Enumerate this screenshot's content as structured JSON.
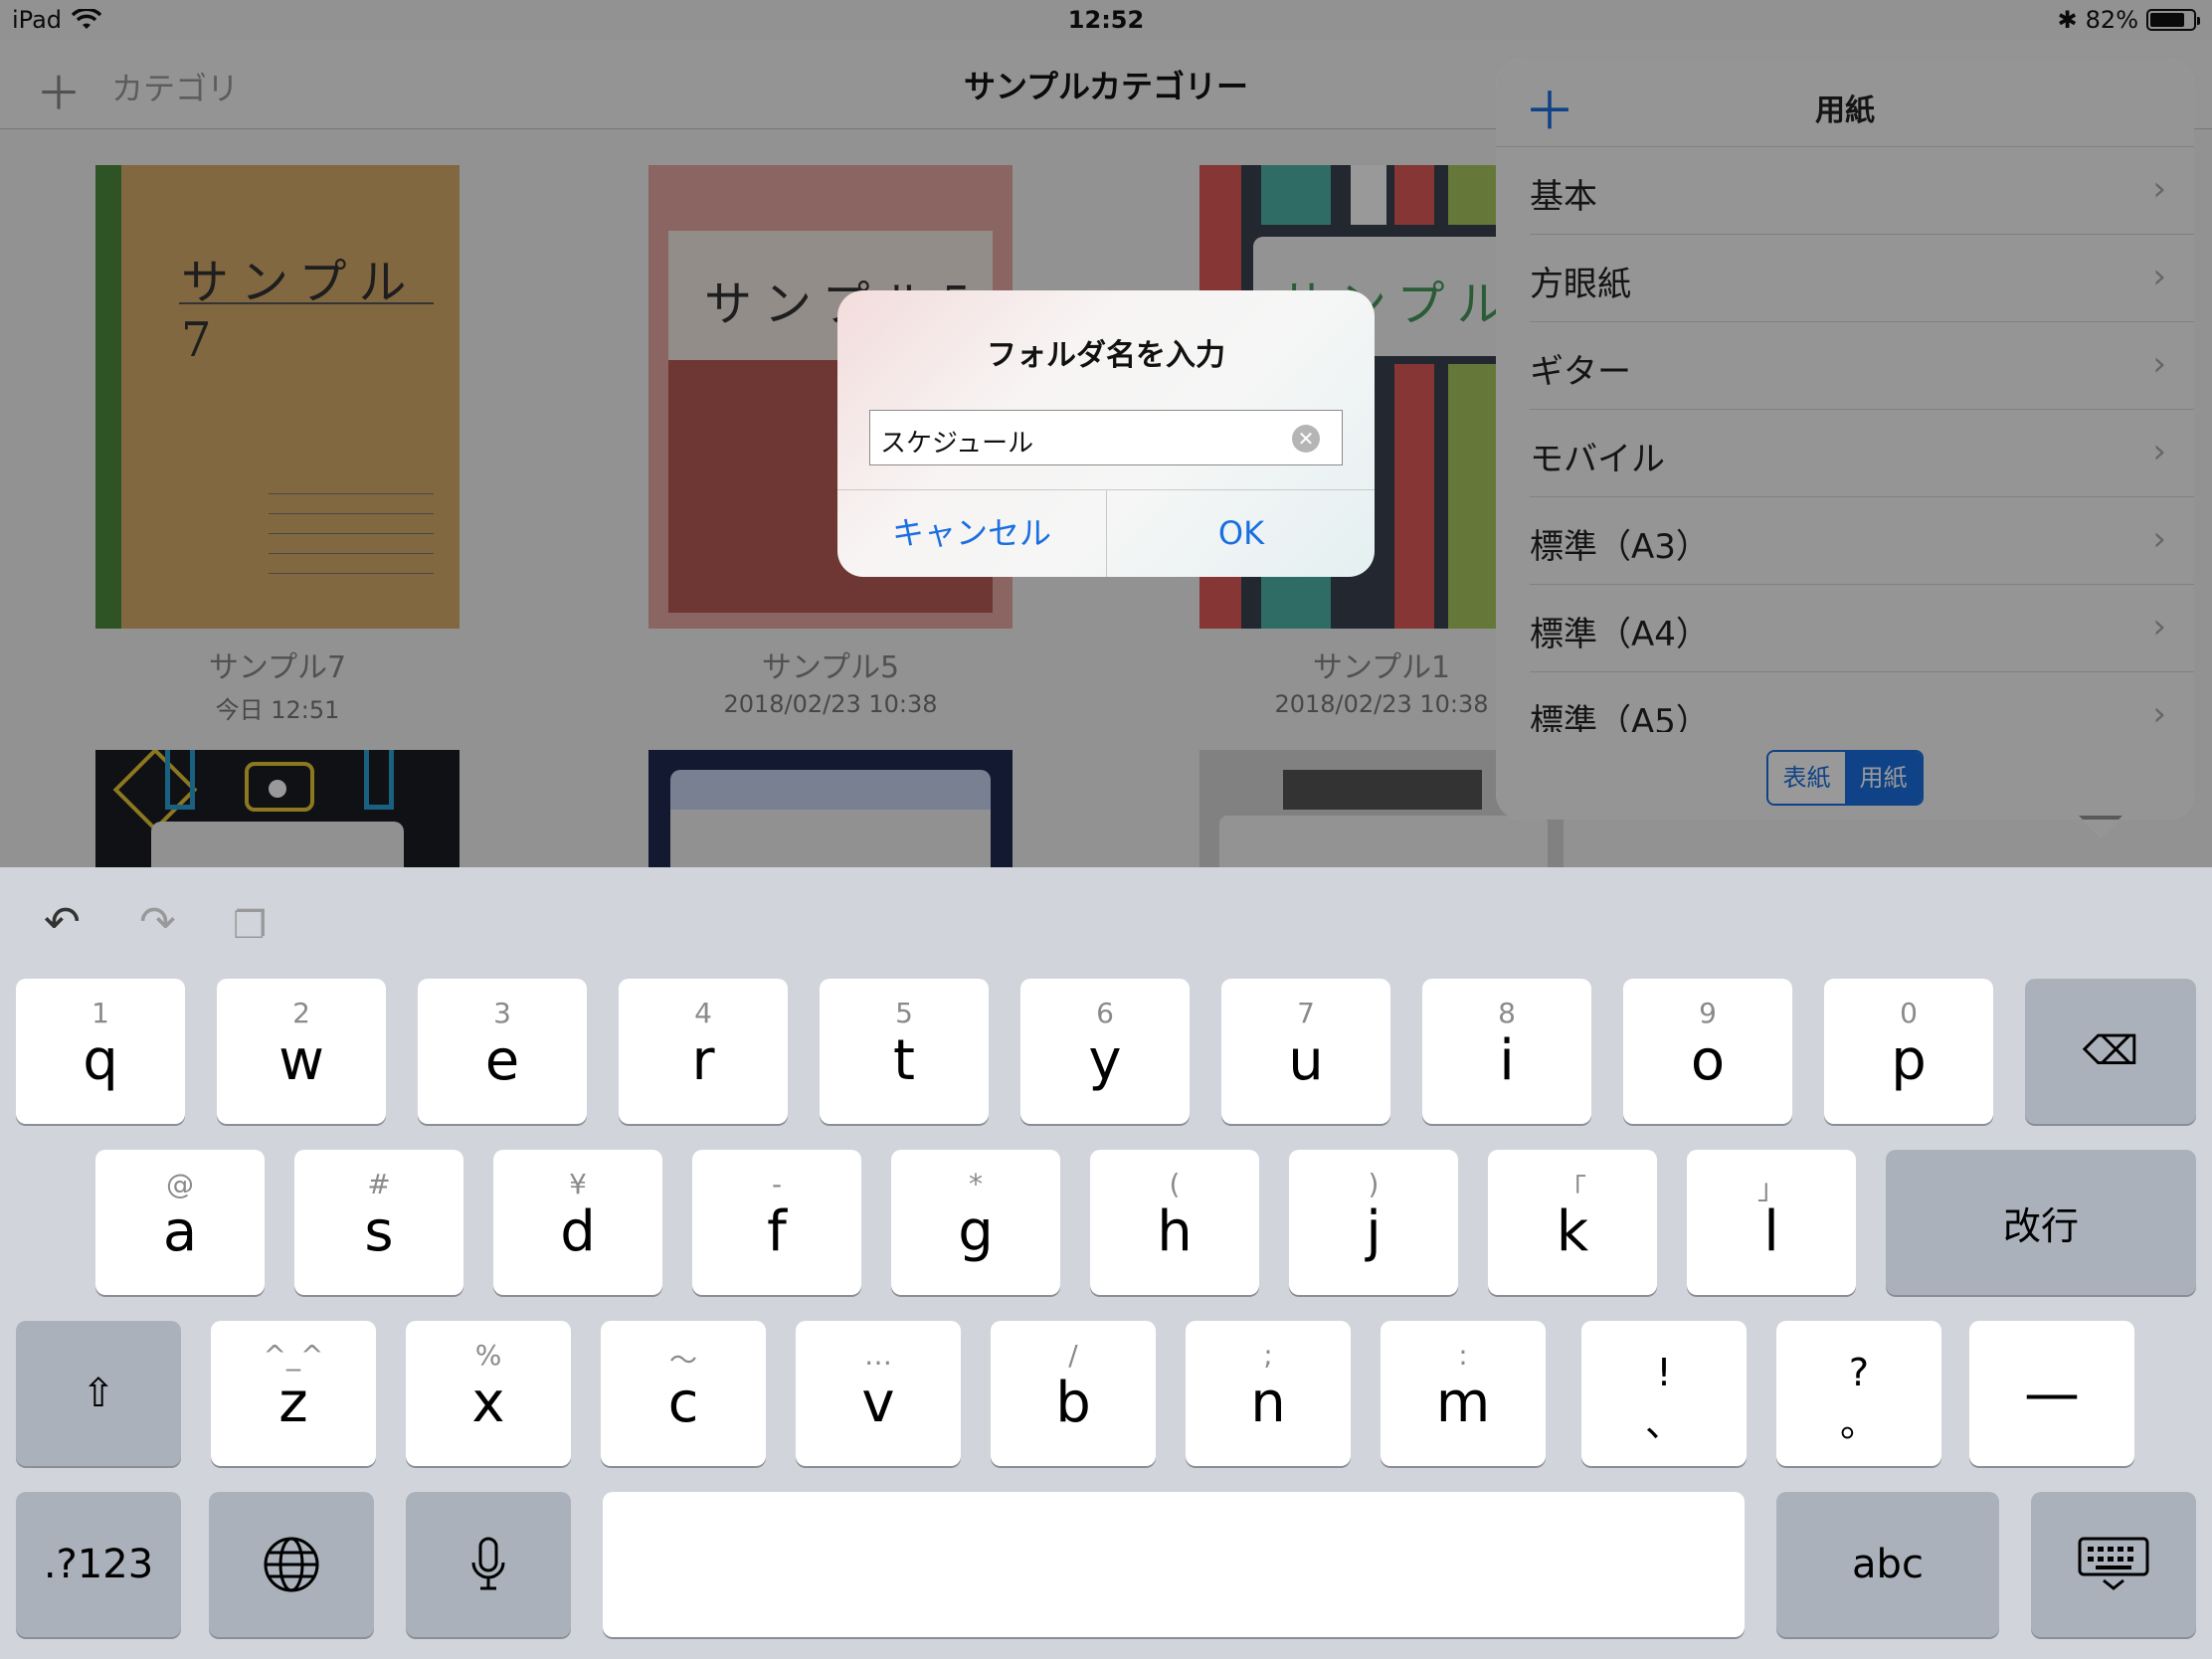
{
  "status": {
    "device": "iPad",
    "time": "12:52",
    "battery": "82%",
    "battery_level": 0.82
  },
  "nav": {
    "add_icon": "plus-icon",
    "category_label": "カテゴリ",
    "title": "サンプルカテゴリー"
  },
  "notebooks": [
    {
      "name": "サンプル7",
      "date": "今日 12:51",
      "cover_text": "サンプル7"
    },
    {
      "name": "サンプル5",
      "date": "2018/02/23 10:38",
      "cover_text": "サンプル5"
    },
    {
      "name": "サンプル1",
      "date": "2018/02/23 10:38",
      "cover_text": "サンプル1"
    }
  ],
  "popover": {
    "title": "用紙",
    "items": [
      {
        "label": "基本"
      },
      {
        "label": "方眼紙"
      },
      {
        "label": "ギター"
      },
      {
        "label": "モバイル"
      },
      {
        "label": "標準（A3）"
      },
      {
        "label": "標準（A4）"
      },
      {
        "label": "標準（A5）"
      }
    ],
    "segments": {
      "cover": "表紙",
      "paper": "用紙"
    }
  },
  "alert": {
    "title": "フォルダ名を入力",
    "input_value": "スケジュール",
    "cancel": "キャンセル",
    "ok": "OK"
  },
  "keyboard": {
    "row1": [
      {
        "hint": "1",
        "key": "q"
      },
      {
        "hint": "2",
        "key": "w"
      },
      {
        "hint": "3",
        "key": "e"
      },
      {
        "hint": "4",
        "key": "r"
      },
      {
        "hint": "5",
        "key": "t"
      },
      {
        "hint": "6",
        "key": "y"
      },
      {
        "hint": "7",
        "key": "u"
      },
      {
        "hint": "8",
        "key": "i"
      },
      {
        "hint": "9",
        "key": "o"
      },
      {
        "hint": "0",
        "key": "p"
      }
    ],
    "row2": [
      {
        "hint": "@",
        "key": "a"
      },
      {
        "hint": "#",
        "key": "s"
      },
      {
        "hint": "¥",
        "key": "d"
      },
      {
        "hint": "-",
        "key": "f"
      },
      {
        "hint": "*",
        "key": "g"
      },
      {
        "hint": "(",
        "key": "h"
      },
      {
        "hint": ")",
        "key": "j"
      },
      {
        "hint": "「",
        "key": "k"
      },
      {
        "hint": "」",
        "key": "l"
      }
    ],
    "row3": [
      {
        "hint": "^_^",
        "key": "z"
      },
      {
        "hint": "%",
        "key": "x"
      },
      {
        "hint": "〜",
        "key": "c"
      },
      {
        "hint": "…",
        "key": "v"
      },
      {
        "hint": "/",
        "key": "b"
      },
      {
        "hint": ";",
        "key": "n"
      },
      {
        "hint": ":",
        "key": "m"
      }
    ],
    "punct": [
      {
        "top": "!",
        "bottom": "、"
      },
      {
        "top": "?",
        "bottom": "。"
      }
    ],
    "dash": "—",
    "return": "改行",
    "numbers": ".?123",
    "abc": "abc"
  }
}
